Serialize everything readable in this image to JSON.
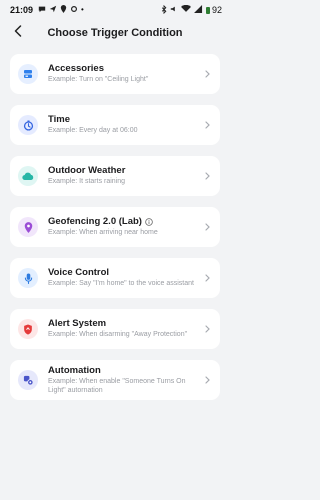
{
  "status_bar": {
    "time": "21:09",
    "battery": "92"
  },
  "header": {
    "title": "Choose Trigger Condition"
  },
  "items": [
    {
      "title": "Accessories",
      "subtitle": "Example: Turn on \"Ceiling Light\"",
      "icon": "accessory-icon",
      "color": "#2f80ed",
      "bg": "#e6efff"
    },
    {
      "title": "Time",
      "subtitle": "Example: Every day at 06:00",
      "icon": "clock-icon",
      "color": "#3565e0",
      "bg": "#e5ebff"
    },
    {
      "title": "Outdoor Weather",
      "subtitle": "Example: It starts raining",
      "icon": "cloud-icon",
      "color": "#26b6a6",
      "bg": "#dff6f3"
    },
    {
      "title": "Geofencing 2.0 (Lab)",
      "subtitle": "Example: When arriving near home",
      "icon": "location-pin-icon",
      "color": "#9b4dd6",
      "bg": "#f1e6fb"
    },
    {
      "title": "Voice Control",
      "subtitle": "Example: Say \"I'm home\" to the voice assistant",
      "icon": "microphone-icon",
      "color": "#2d7be0",
      "bg": "#e3efff"
    },
    {
      "title": "Alert System",
      "subtitle": "Example: When disarming \"Away Protection\"",
      "icon": "shield-icon",
      "color": "#e53b3b",
      "bg": "#fde6e6"
    },
    {
      "title": "Automation",
      "subtitle": "Example: When enable \"Someone Turns On Light\" autornation",
      "icon": "automation-icon",
      "color": "#4a55c9",
      "bg": "#e6e8fb"
    }
  ]
}
